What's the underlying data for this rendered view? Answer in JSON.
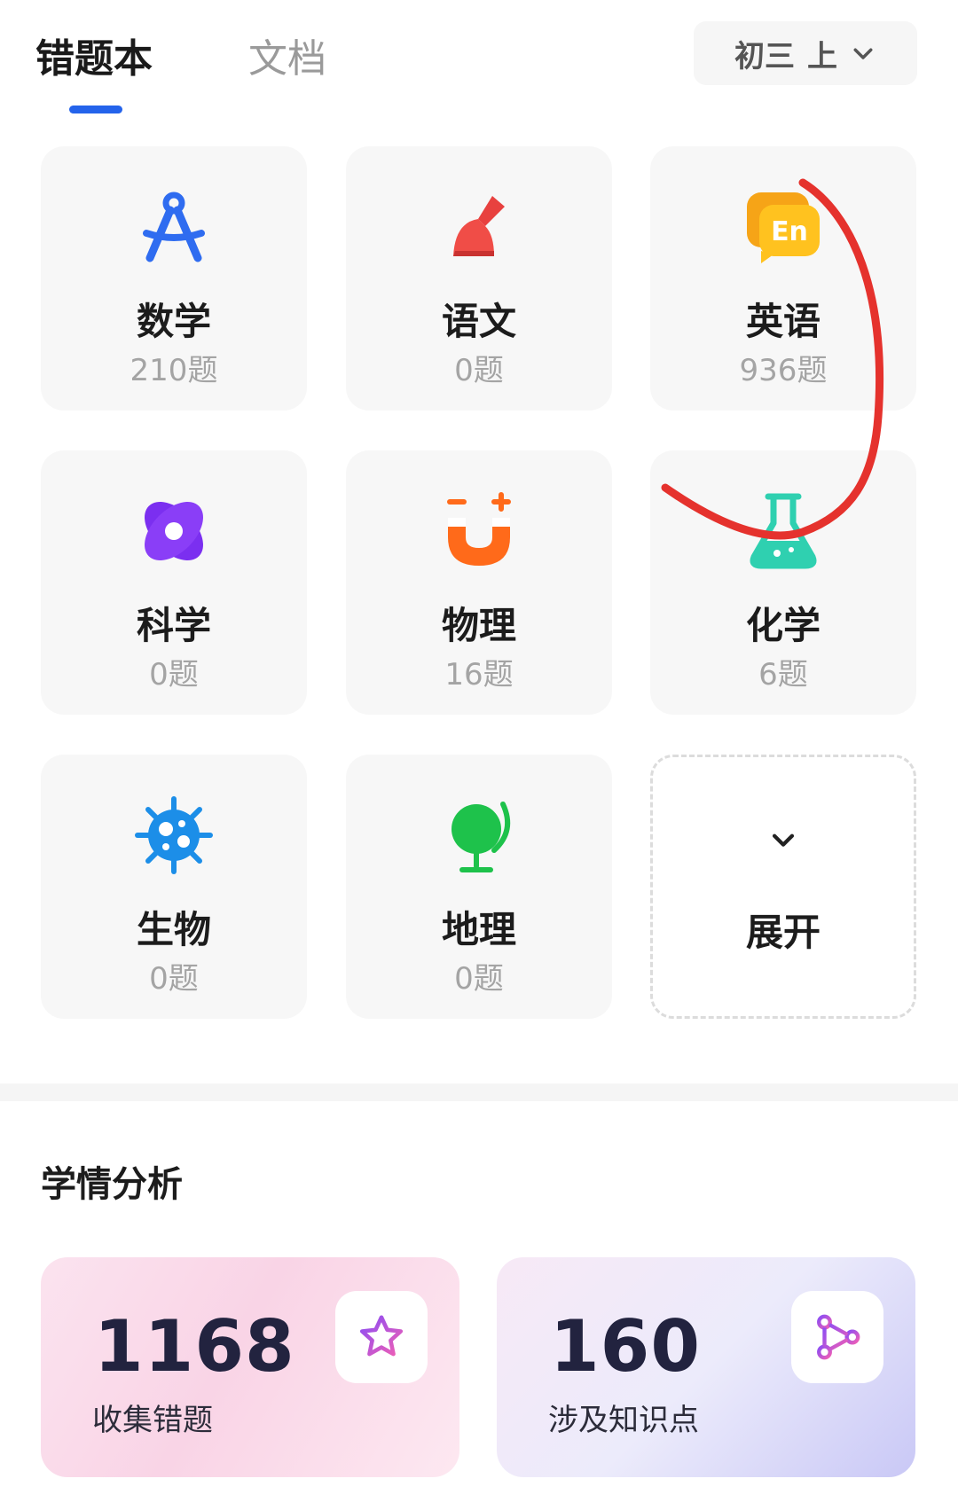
{
  "tabs": {
    "active": "错题本",
    "inactive": "文档"
  },
  "grade": {
    "level": "初三",
    "term": "上"
  },
  "subjects": [
    {
      "name": "数学",
      "count": "210题",
      "icon": "compass-icon"
    },
    {
      "name": "语文",
      "count": "0题",
      "icon": "brush-icon"
    },
    {
      "name": "英语",
      "count": "936题",
      "icon": "english-bubble-icon",
      "icon_text": "En"
    },
    {
      "name": "科学",
      "count": "0题",
      "icon": "atom-icon"
    },
    {
      "name": "物理",
      "count": "16题",
      "icon": "magnet-icon"
    },
    {
      "name": "化学",
      "count": "6题",
      "icon": "flask-icon"
    },
    {
      "name": "生物",
      "count": "0题",
      "icon": "virus-icon"
    },
    {
      "name": "地理",
      "count": "0题",
      "icon": "globe-icon"
    }
  ],
  "expand_label": "展开",
  "analysis": {
    "title": "学情分析",
    "stats": [
      {
        "value": "1168",
        "label": "收集错题",
        "icon": "star-icon"
      },
      {
        "value": "160",
        "label": "涉及知识点",
        "icon": "network-icon"
      }
    ]
  },
  "colors": {
    "accent": "#2463eb",
    "annotation": "#e5322d"
  }
}
